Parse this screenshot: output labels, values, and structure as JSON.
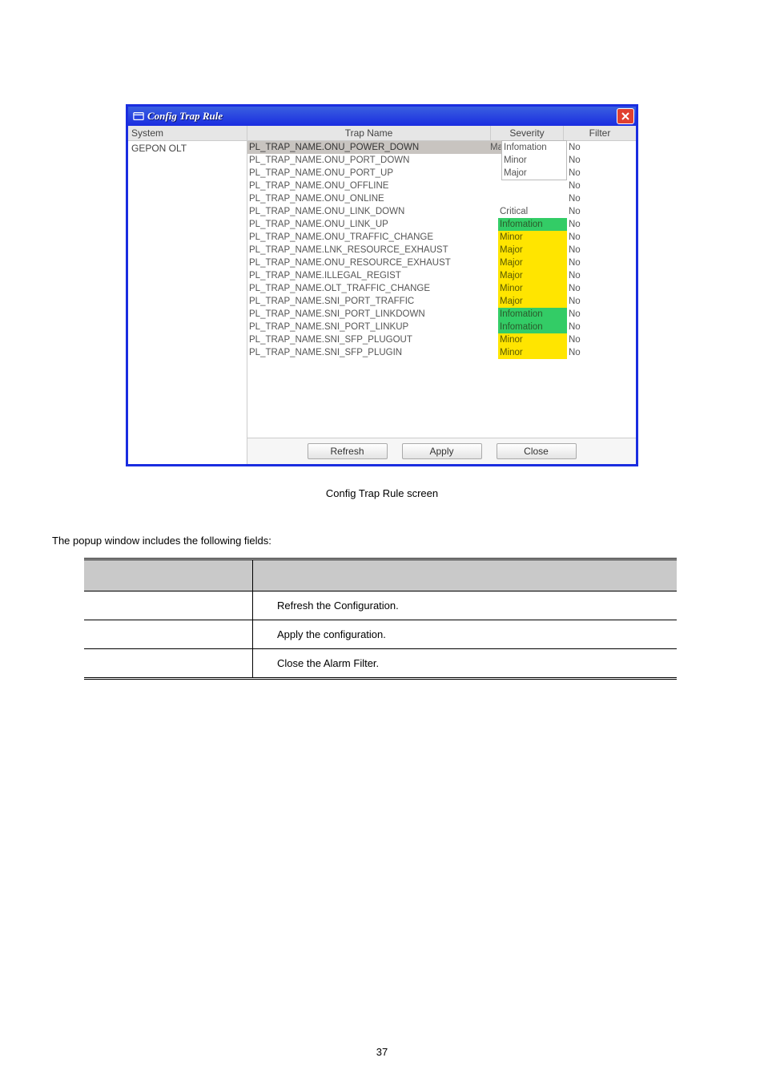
{
  "dialog": {
    "title": "Config Trap Rule",
    "sidebar_header": "System",
    "sidebar_items": [
      "GEPON OLT"
    ],
    "columns": {
      "trap": "Trap Name",
      "severity": "Severity",
      "filter": "Filter"
    },
    "callout": [
      "Infomation",
      "Minor",
      "Major"
    ],
    "rows": [
      {
        "trap": "PL_TRAP_NAME.ONU_POWER_DOWN",
        "severity": "Major",
        "sev_style": "dropdown",
        "filter": "No",
        "selected": true
      },
      {
        "trap": "PL_TRAP_NAME.ONU_PORT_DOWN",
        "severity": "",
        "sev_style": "plain",
        "filter": "No"
      },
      {
        "trap": "PL_TRAP_NAME.ONU_PORT_UP",
        "severity": "",
        "sev_style": "plain",
        "filter": "No"
      },
      {
        "trap": "PL_TRAP_NAME.ONU_OFFLINE",
        "severity": "",
        "sev_style": "plain",
        "filter": "No"
      },
      {
        "trap": "PL_TRAP_NAME.ONU_ONLINE",
        "severity": "",
        "sev_style": "plain",
        "filter": "No"
      },
      {
        "trap": "PL_TRAP_NAME.ONU_LINK_DOWN",
        "severity": "Critical",
        "sev_style": "plain",
        "filter": "No"
      },
      {
        "trap": "PL_TRAP_NAME.ONU_LINK_UP",
        "severity": "Infomation",
        "sev_style": "green",
        "filter": "No"
      },
      {
        "trap": "PL_TRAP_NAME.ONU_TRAFFIC_CHANGE",
        "severity": "Minor",
        "sev_style": "yellow",
        "filter": "No"
      },
      {
        "trap": "PL_TRAP_NAME.LNK_RESOURCE_EXHAUST",
        "severity": "Major",
        "sev_style": "yellow",
        "filter": "No"
      },
      {
        "trap": "PL_TRAP_NAME.ONU_RESOURCE_EXHAUST",
        "severity": "Major",
        "sev_style": "yellow",
        "filter": "No"
      },
      {
        "trap": "PL_TRAP_NAME.ILLEGAL_REGIST",
        "severity": "Major",
        "sev_style": "yellow",
        "filter": "No"
      },
      {
        "trap": "PL_TRAP_NAME.OLT_TRAFFIC_CHANGE",
        "severity": "Minor",
        "sev_style": "yellow",
        "filter": "No"
      },
      {
        "trap": "PL_TRAP_NAME.SNI_PORT_TRAFFIC",
        "severity": "Major",
        "sev_style": "yellow",
        "filter": "No"
      },
      {
        "trap": "PL_TRAP_NAME.SNI_PORT_LINKDOWN",
        "severity": "Infomation",
        "sev_style": "green",
        "filter": "No"
      },
      {
        "trap": "PL_TRAP_NAME.SNI_PORT_LINKUP",
        "severity": "Infomation",
        "sev_style": "green",
        "filter": "No"
      },
      {
        "trap": "PL_TRAP_NAME.SNI_SFP_PLUGOUT",
        "severity": "Minor",
        "sev_style": "yellow",
        "filter": "No"
      },
      {
        "trap": "PL_TRAP_NAME.SNI_SFP_PLUGIN",
        "severity": "Minor",
        "sev_style": "yellow",
        "filter": "No"
      }
    ],
    "buttons": {
      "refresh": "Refresh",
      "apply": "Apply",
      "close": "Close"
    }
  },
  "caption": "Config Trap Rule screen",
  "intro": "The popup window includes the following fields:",
  "desc_table": {
    "rows": [
      {
        "object": "",
        "description": "Refresh the Configuration."
      },
      {
        "object": "",
        "description": "Apply the configuration."
      },
      {
        "object": "",
        "description": "Close the Alarm Filter."
      }
    ]
  },
  "page_number": "37"
}
